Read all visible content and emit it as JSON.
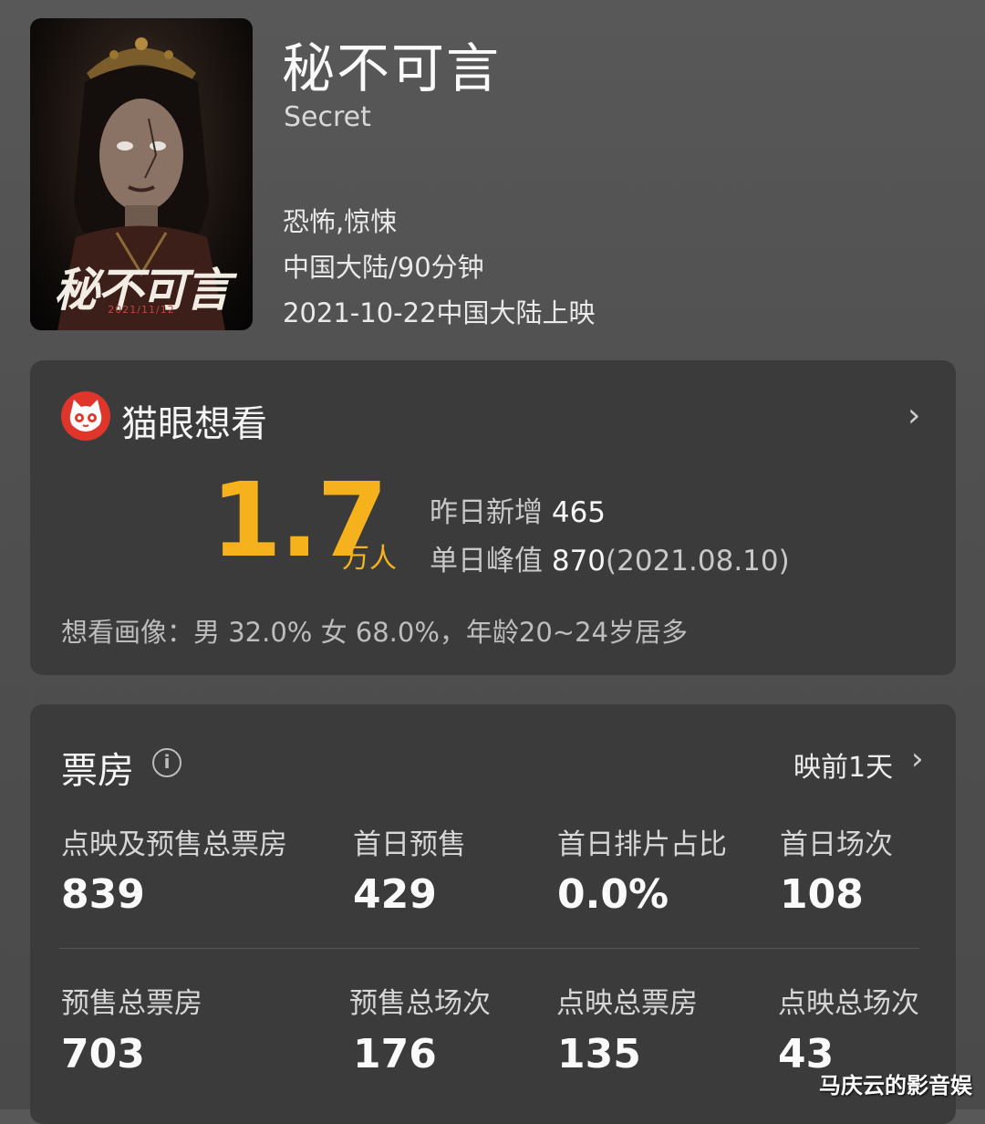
{
  "movie": {
    "poster_title": "秘不可言",
    "poster_date": "2021/11/12",
    "title": "秘不可言",
    "english_title": "Secret",
    "genre": "恐怖,惊悚",
    "region_duration": "中国大陆/90分钟",
    "release": "2021-10-22中国大陆上映"
  },
  "want_to_see": {
    "title": "猫眼想看",
    "count": "1.7",
    "unit": "万人",
    "yesterday_label": "昨日新增 ",
    "yesterday_value": "465",
    "peak_label": "单日峰值 ",
    "peak_value": "870",
    "peak_date": "(2021.08.10)",
    "portrait": "想看画像：男 32.0%  女 68.0%，年龄20~24岁居多"
  },
  "box_office": {
    "title": "票房",
    "info_icon": "i",
    "status": "映前1天",
    "row1": [
      {
        "label": "点映及预售总票房",
        "value": "839"
      },
      {
        "label": "首日预售",
        "value": "429"
      },
      {
        "label": "首日排片占比",
        "value": "0.0%"
      },
      {
        "label": "首日场次",
        "value": "108"
      }
    ],
    "row2": [
      {
        "label": "预售总票房",
        "value": "703"
      },
      {
        "label": "预售总场次",
        "value": "176"
      },
      {
        "label": "点映总票房",
        "value": "135"
      },
      {
        "label": "点映总场次",
        "value": "43"
      }
    ]
  },
  "watermark": "马庆云的影音娱",
  "colors": {
    "accent": "#f6b21c",
    "brand_red": "#e0352b",
    "card": "#3b3b3b",
    "background": "#545454"
  },
  "icons": {
    "maoyan": "maoyan-cat-logo",
    "chevron": "chevron-right-icon",
    "info": "info-circle-icon"
  }
}
